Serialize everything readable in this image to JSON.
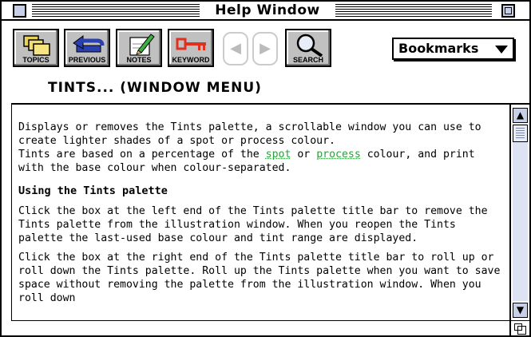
{
  "window": {
    "title": "Help Window"
  },
  "toolbar": {
    "buttons": [
      {
        "label": "TOPICS",
        "icon": "folders-icon"
      },
      {
        "label": "PREVIOUS",
        "icon": "back-arrow-icon"
      },
      {
        "label": "NOTES",
        "icon": "pencil-note-icon"
      },
      {
        "label": "KEYWORD",
        "icon": "key-icon"
      },
      {
        "label": "SEARCH",
        "icon": "magnifier-icon"
      }
    ],
    "browse_back_icon": "browse-back-icon",
    "browse_forward_icon": "browse-forward-icon"
  },
  "bookmarks": {
    "label": "Bookmarks"
  },
  "topic": {
    "title": "TINTS... (WINDOW MENU)"
  },
  "content": {
    "intro_1": "Displays or removes the Tints palette, a scrollable window you can use to create lighter shades of a spot or process colour.",
    "intro_2_a": "Tints are based on a percentage of the ",
    "link_spot": "spot",
    "intro_2_b": " or ",
    "link_process": "process",
    "intro_2_c": " colour, and print with the base colour when colour-separated.",
    "heading": "Using the Tints palette",
    "para_1": "Click the box at the left end of the Tints palette title bar to remove the Tints palette from the illustration window. When you reopen the Tints palette the last-used base colour and tint range are displayed.",
    "para_2": "Click the box at the right end of the Tints palette title bar to roll up or roll down the Tints palette. Roll up the Tints palette when you want to save space without removing the palette from the illustration window. When you roll down"
  },
  "colors": {
    "link": "#2e9e3c",
    "scroll_accent": "#c8d0e8"
  }
}
